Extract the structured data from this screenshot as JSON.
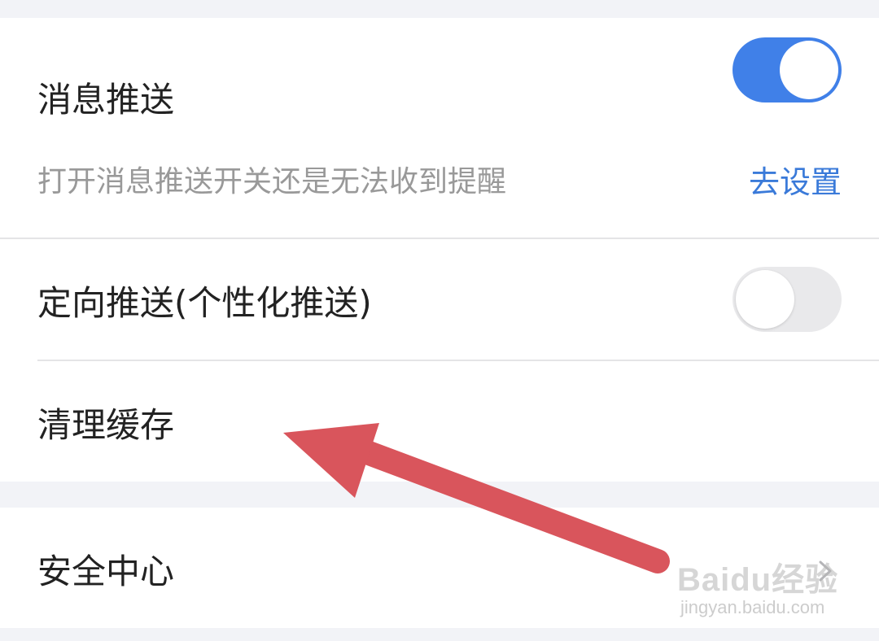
{
  "settings": {
    "push": {
      "title": "消息推送",
      "toggle_on": true,
      "hint": "打开消息推送开关还是无法收到提醒",
      "hint_link": "去设置"
    },
    "targeted_push": {
      "title": "定向推送(个性化推送)",
      "toggle_on": false
    },
    "clear_cache": {
      "title": "清理缓存"
    },
    "security_center": {
      "title": "安全中心"
    }
  },
  "annotation": {
    "arrow_color": "#d9555c"
  },
  "watermark": {
    "logo_text": "Baidu经验",
    "url_text": "jingyan.baidu.com"
  },
  "colors": {
    "toggle_on": "#4080e8",
    "toggle_off": "#e9e9eb",
    "link": "#3a7ad9",
    "background": "#f2f3f7"
  },
  "icons": {
    "chevron": "chevron-right-icon"
  }
}
